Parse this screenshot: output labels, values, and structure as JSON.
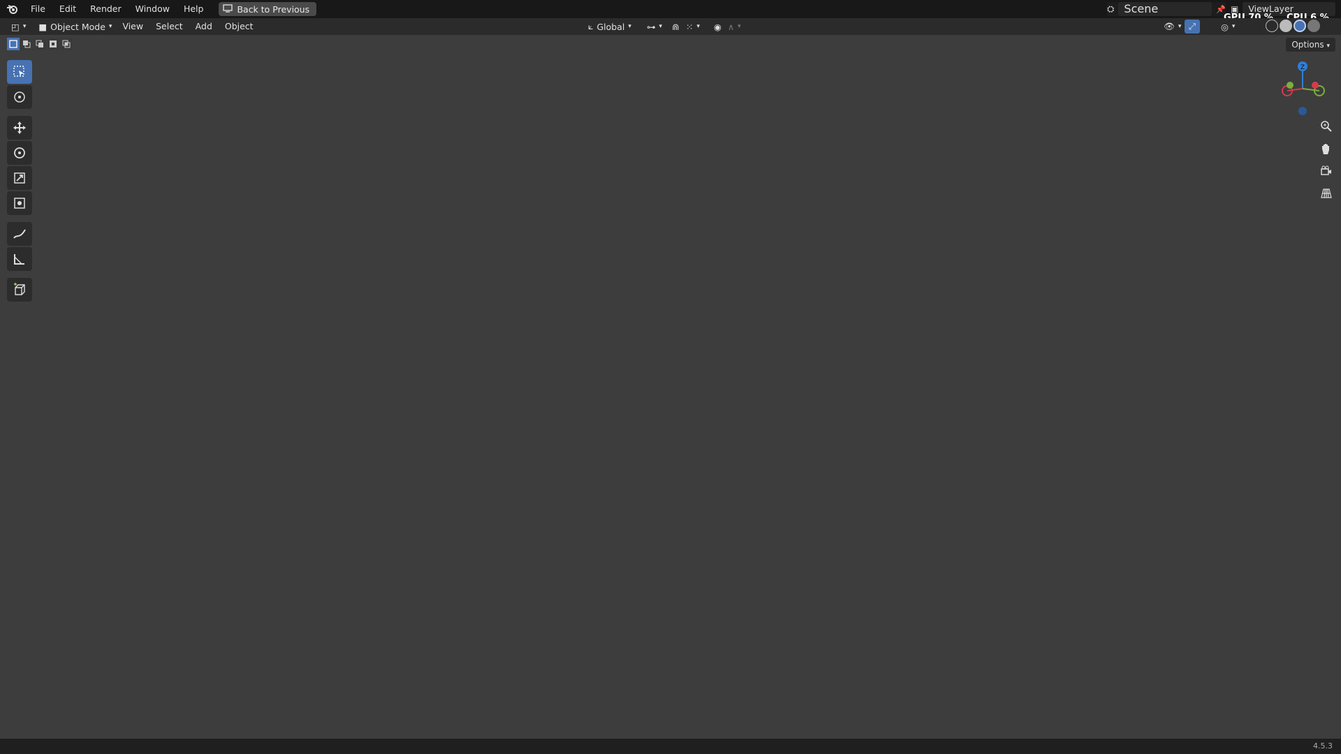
{
  "topbar": {
    "menus": [
      "File",
      "Edit",
      "Render",
      "Window",
      "Help"
    ],
    "back_button": "Back to Previous",
    "scene_label": "Scene",
    "view_layer_label": "ViewLayer",
    "gpu_label": "GPU",
    "gpu_value": "70 %",
    "cpu_label": "CPU",
    "cpu_value": "6 %"
  },
  "header": {
    "mode": "Object Mode",
    "menus": [
      "View",
      "Select",
      "Add",
      "Object"
    ],
    "transform_orientation": "Global",
    "options_label": "Options"
  },
  "toolbar": {
    "tools": [
      "select-box",
      "cursor",
      "move",
      "rotate",
      "scale",
      "transform",
      "annotate",
      "measure",
      "add-cube"
    ],
    "active": "select-box"
  },
  "gizmo": {
    "axes": [
      "Z",
      "Y",
      "X"
    ]
  },
  "status": {
    "version": "4.5.3"
  },
  "colors": {
    "accent": "#4772b3",
    "roof": "#2e6b57",
    "wall": "#a8a48e",
    "background": "#3d3d3d"
  }
}
